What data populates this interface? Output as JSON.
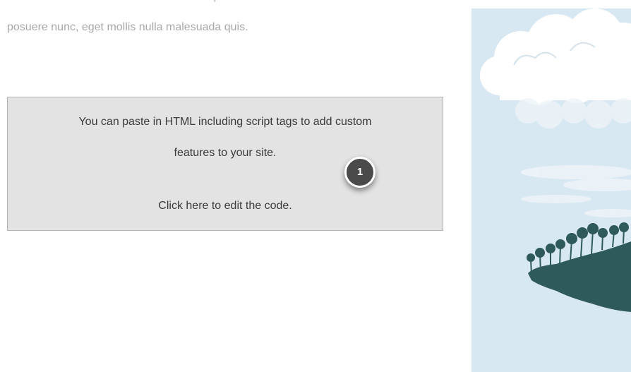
{
  "content": {
    "paragraph_cut_line": "convallis. In est et nulla. Etiam ut nulla sapien. Nullam at lacinia",
    "paragraph_line": "posuere nunc, eget mollis nulla malesuada quis."
  },
  "html_widget": {
    "line1": "You can paste in HTML including script tags to add custom",
    "line2": "features to your site.",
    "line3": "Click here to edit the code."
  },
  "callout": {
    "number": "1"
  },
  "colors": {
    "sky": "#d8e8f2",
    "cloud": "#ffffff",
    "island": "#2f5a5c",
    "widget_bg": "#e3e3e3",
    "marker_bg": "#4a4a4a"
  }
}
